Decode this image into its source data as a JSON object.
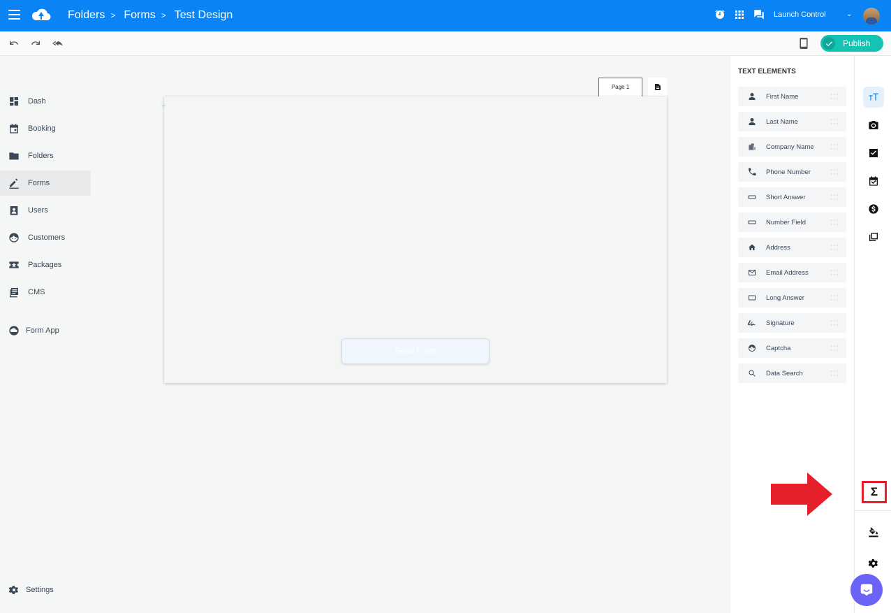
{
  "header": {
    "breadcrumbs": [
      "Folders",
      "Forms",
      "Test Design"
    ],
    "account_label": "Launch Control"
  },
  "toolbar": {
    "publish_label": "Publish"
  },
  "sidebar": {
    "items": [
      {
        "label": "Dash",
        "icon": "dashboard-icon"
      },
      {
        "label": "Booking",
        "icon": "calendar-icon"
      },
      {
        "label": "Folders",
        "icon": "folder-icon"
      },
      {
        "label": "Forms",
        "icon": "pencil-icon",
        "active": true
      },
      {
        "label": "Users",
        "icon": "user-badge-icon"
      },
      {
        "label": "Customers",
        "icon": "face-icon"
      },
      {
        "label": "Packages",
        "icon": "star-ticket-icon"
      },
      {
        "label": "CMS",
        "icon": "document-list-icon"
      }
    ],
    "form_app_label": "Form App",
    "settings_label": "Settings"
  },
  "canvas": {
    "page_tab_label": "Page 1",
    "send_button_label": "Send Form"
  },
  "elements_panel": {
    "title": "TEXT ELEMENTS",
    "items": [
      {
        "label": "First Name",
        "icon": "person-icon"
      },
      {
        "label": "Last Name",
        "icon": "person-icon"
      },
      {
        "label": "Company Name",
        "icon": "building-icon"
      },
      {
        "label": "Phone Number",
        "icon": "phone-icon"
      },
      {
        "label": "Short Answer",
        "icon": "short-input-icon"
      },
      {
        "label": "Number Field",
        "icon": "short-input-icon"
      },
      {
        "label": "Address",
        "icon": "home-icon"
      },
      {
        "label": "Email Address",
        "icon": "mail-icon"
      },
      {
        "label": "Long Answer",
        "icon": "long-input-icon"
      },
      {
        "label": "Signature",
        "icon": "signature-icon"
      },
      {
        "label": "Captcha",
        "icon": "face-icon"
      },
      {
        "label": "Data Search",
        "icon": "search-icon"
      }
    ]
  },
  "rail": {
    "sigma_symbol": "Σ"
  },
  "colors": {
    "topbar": "#0a84f5",
    "publish": "#13c3b4",
    "highlight": "#e6202a",
    "chat": "#6a63f5"
  }
}
